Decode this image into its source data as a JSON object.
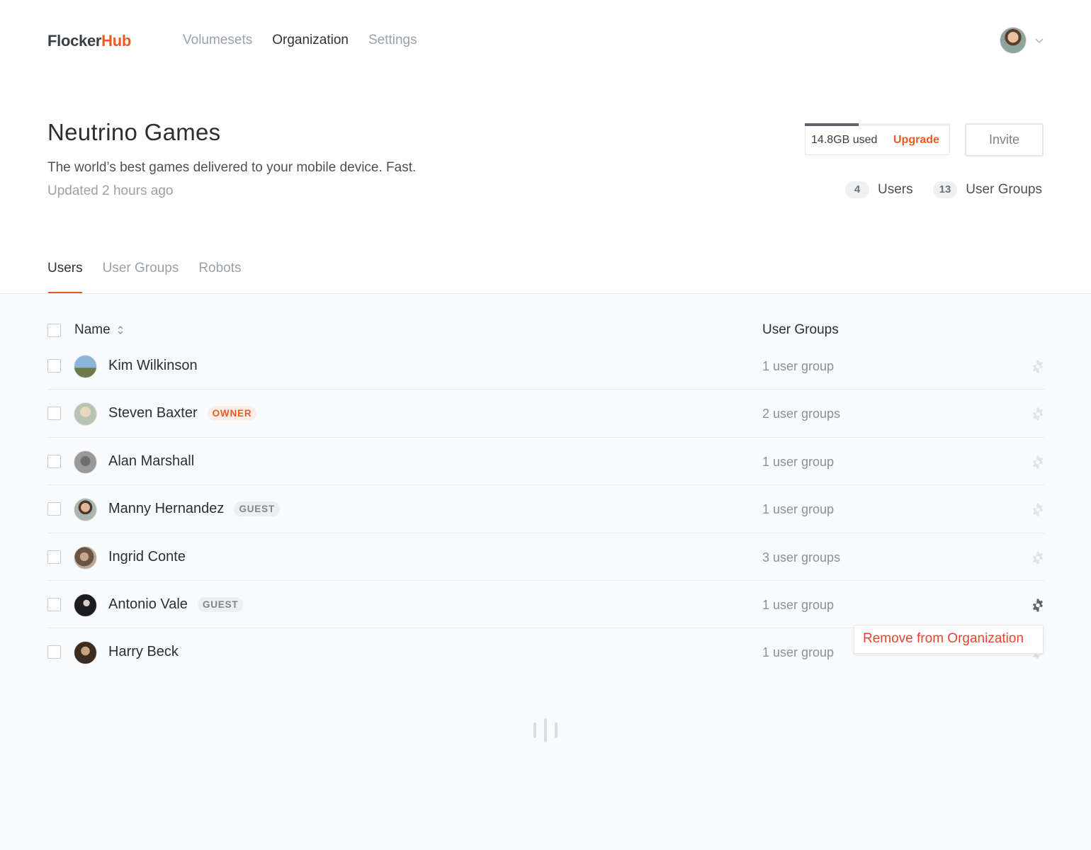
{
  "brand": {
    "part1": "Flocker",
    "part2": "Hub"
  },
  "nav": {
    "items": [
      {
        "label": "Volumesets",
        "active": false
      },
      {
        "label": "Organization",
        "active": true
      },
      {
        "label": "Settings",
        "active": false
      }
    ]
  },
  "org": {
    "title": "Neutrino Games",
    "description": "The world’s best games delivered to your mobile device.  Fast.",
    "updated": "Updated 2 hours ago"
  },
  "storage": {
    "used_label": "14.8GB used",
    "upgrade_label": "Upgrade",
    "fill_fraction": 0.37
  },
  "invite_label": "Invite",
  "counts": {
    "users": {
      "value": "4",
      "label": "Users"
    },
    "groups": {
      "value": "13",
      "label": "User Groups"
    }
  },
  "tabs": [
    {
      "label": "Users",
      "active": true
    },
    {
      "label": "User Groups",
      "active": false
    },
    {
      "label": "Robots",
      "active": false
    }
  ],
  "table": {
    "headers": {
      "name": "Name",
      "groups": "User Groups"
    },
    "rows": [
      {
        "name": "Kim Wilkinson",
        "badge": "",
        "groups": "1 user group"
      },
      {
        "name": "Steven Baxter",
        "badge": "OWNER",
        "groups": "2 user groups"
      },
      {
        "name": "Alan Marshall",
        "badge": "",
        "groups": "1 user group"
      },
      {
        "name": "Manny Hernandez",
        "badge": "GUEST",
        "groups": "1 user group"
      },
      {
        "name": "Ingrid Conte",
        "badge": "",
        "groups": "3 user groups"
      },
      {
        "name": "Antonio Vale",
        "badge": "GUEST",
        "groups": "1 user group"
      },
      {
        "name": "Harry Beck",
        "badge": "",
        "groups": "1 user group"
      }
    ]
  },
  "row_menu": {
    "remove_label": "Remove from Organization",
    "open_row_index": 5
  },
  "colors": {
    "accent": "#ec5a24",
    "danger": "#e8442e",
    "text": "#2b2f33",
    "muted": "#9aa1a8"
  }
}
